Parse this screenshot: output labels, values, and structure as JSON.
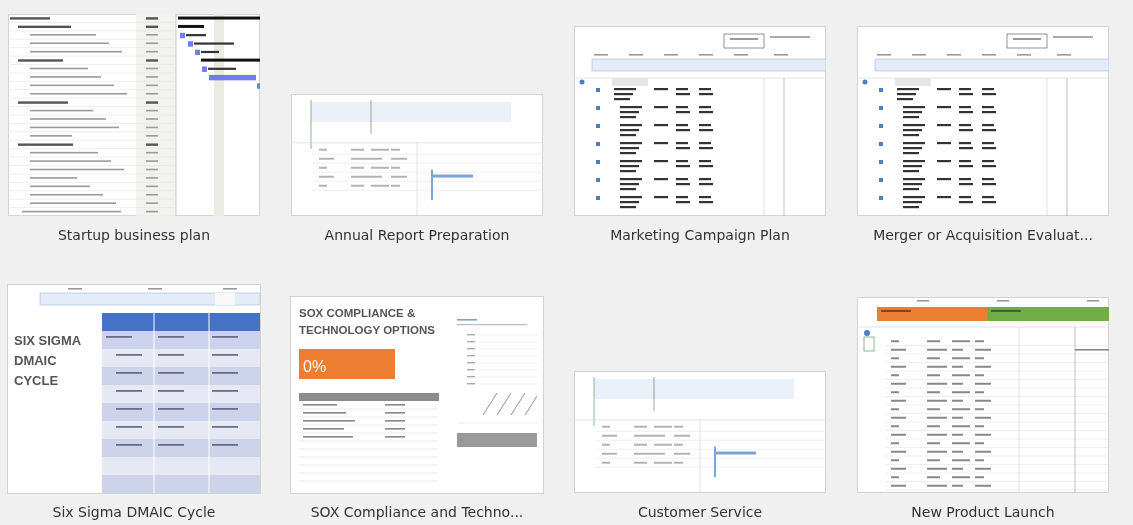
{
  "templates": [
    {
      "title": "Startup business plan",
      "kind": "gantt-outline"
    },
    {
      "title": "Annual Report Preparation",
      "kind": "gantt-sparse"
    },
    {
      "title": "Marketing Campaign Plan",
      "kind": "gantt-detail"
    },
    {
      "title": "Merger or Acquisition Evaluat...",
      "kind": "gantt-detail"
    },
    {
      "title": "Six Sigma DMAIC Cycle",
      "kind": "dmaic",
      "heading": "SIX SIGMA DMAIC CYCLE"
    },
    {
      "title": "SOX Compliance and Techno...",
      "kind": "report",
      "heading": "SOX COMPLIANCE & TECHNOLOGY OPTIONS",
      "percent": "0%"
    },
    {
      "title": "Customer Service",
      "kind": "gantt-sparse"
    },
    {
      "title": "New Product Launch",
      "kind": "phase-bars"
    }
  ]
}
